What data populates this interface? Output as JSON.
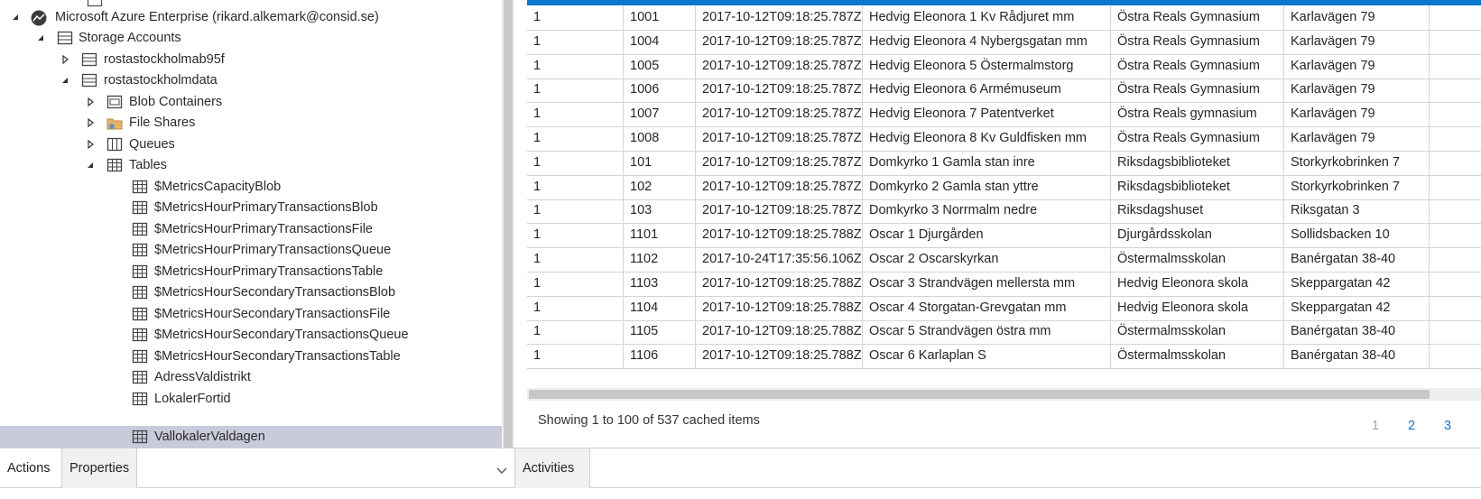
{
  "tree": {
    "account": "Microsoft Azure Enterprise (rikard.alkemark@consid.se)",
    "storage_accounts": "Storage Accounts",
    "storage1": "rostastockholmab95f",
    "storage2": "rostastockholmdata",
    "blob_containers": "Blob Containers",
    "file_shares": "File Shares",
    "queues": "Queues",
    "tables": "Tables",
    "table_items": [
      "$MetricsCapacityBlob",
      "$MetricsHourPrimaryTransactionsBlob",
      "$MetricsHourPrimaryTransactionsFile",
      "$MetricsHourPrimaryTransactionsQueue",
      "$MetricsHourPrimaryTransactionsTable",
      "$MetricsHourSecondaryTransactionsBlob",
      "$MetricsHourSecondaryTransactionsFile",
      "$MetricsHourSecondaryTransactionsQueue",
      "$MetricsHourSecondaryTransactionsTable",
      "AdressValdistrikt",
      "LokalerFortid",
      "VallokalerValdagen"
    ],
    "selected_item": "VallokalerValdagen"
  },
  "table": {
    "rows": [
      [
        "1",
        "1001",
        "2017-10-12T09:18:25.787Z",
        "Hedvig Eleonora 1 Kv Rådjuret mm",
        "Östra Reals Gymnasium",
        "Karlavägen 79"
      ],
      [
        "1",
        "1004",
        "2017-10-12T09:18:25.787Z",
        "Hedvig Eleonora 4 Nybergsgatan mm",
        "Östra Reals Gymnasium",
        "Karlavägen 79"
      ],
      [
        "1",
        "1005",
        "2017-10-12T09:18:25.787Z",
        "Hedvig Eleonora 5 Östermalmstorg",
        "Östra Reals Gymnasium",
        "Karlavägen 79"
      ],
      [
        "1",
        "1006",
        "2017-10-12T09:18:25.787Z",
        "Hedvig Eleonora 6 Armémuseum",
        "Östra Reals Gymnasium",
        "Karlavägen 79"
      ],
      [
        "1",
        "1007",
        "2017-10-12T09:18:25.787Z",
        "Hedvig Eleonora 7 Patentverket",
        "Östra Reals gymnasium",
        "Karlavägen 79"
      ],
      [
        "1",
        "1008",
        "2017-10-12T09:18:25.787Z",
        "Hedvig Eleonora 8 Kv Guldfisken mm",
        "Östra Reals Gymnasium",
        "Karlavägen 79"
      ],
      [
        "1",
        "101",
        "2017-10-12T09:18:25.787Z",
        "Domkyrko 1 Gamla stan inre",
        "Riksdagsbiblioteket",
        "Storkyrkobrinken 7"
      ],
      [
        "1",
        "102",
        "2017-10-12T09:18:25.787Z",
        "Domkyrko 2 Gamla stan yttre",
        "Riksdagsbiblioteket",
        "Storkyrkobrinken 7"
      ],
      [
        "1",
        "103",
        "2017-10-12T09:18:25.787Z",
        "Domkyrko 3 Norrmalm nedre",
        "Riksdagshuset",
        "Riksgatan 3"
      ],
      [
        "1",
        "1101",
        "2017-10-12T09:18:25.788Z",
        "Oscar 1 Djurgården",
        "Djurgårdsskolan",
        "Sollidsbacken 10"
      ],
      [
        "1",
        "1102",
        "2017-10-24T17:35:56.106Z",
        "Oscar 2 Oscarskyrkan",
        "Östermalmsskolan",
        "Banérgatan 38-40"
      ],
      [
        "1",
        "1103",
        "2017-10-12T09:18:25.788Z",
        "Oscar 3 Strandvägen mellersta mm",
        "Hedvig Eleonora skola",
        "Skeppargatan 42"
      ],
      [
        "1",
        "1104",
        "2017-10-12T09:18:25.788Z",
        "Oscar 4 Storgatan-Grevgatan mm",
        "Hedvig Eleonora skola",
        "Skeppargatan 42"
      ],
      [
        "1",
        "1105",
        "2017-10-12T09:18:25.788Z",
        "Oscar 5 Strandvägen östra mm",
        "Östermalmsskolan",
        "Banérgatan 38-40"
      ],
      [
        "1",
        "1106",
        "2017-10-12T09:18:25.788Z",
        "Oscar 6 Karlaplan S",
        "Östermalmsskolan",
        "Banérgatan 38-40"
      ]
    ],
    "paging_text": "Showing 1 to 100 of 537 cached items",
    "pages": [
      "1",
      "2",
      "3"
    ],
    "current_page": "1"
  },
  "bottom": {
    "actions_tab": "Actions",
    "properties_tab": "Properties",
    "activities_tab": "Activities"
  },
  "colors": {
    "accent": "#0b78d0",
    "selected_row": "#c8cbdb",
    "link": "#1e6dc4"
  }
}
